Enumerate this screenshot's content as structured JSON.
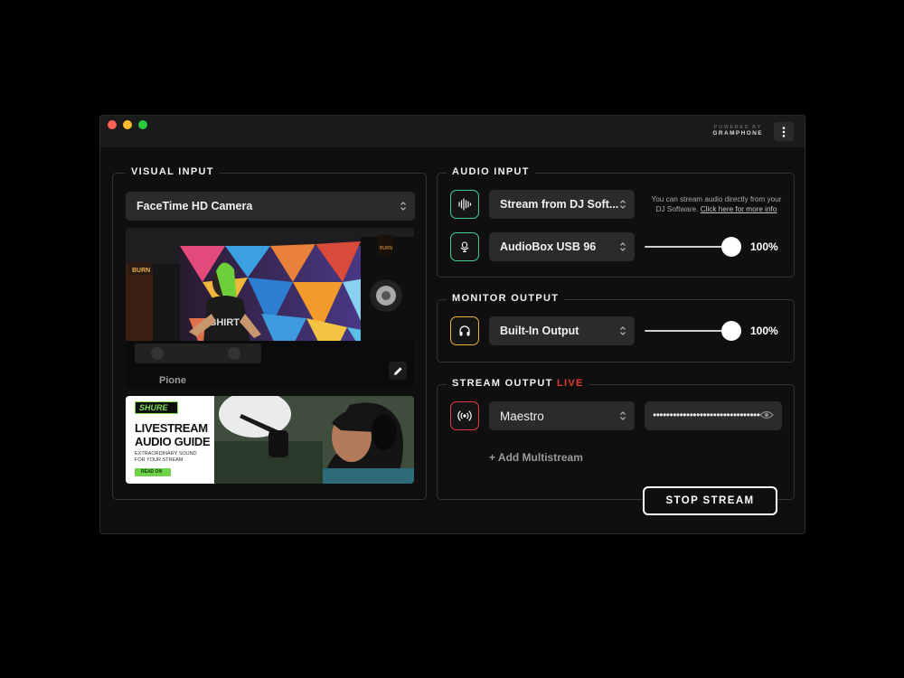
{
  "window": {
    "powered_by": "POWERED BY",
    "brand": "GRAMPHONE"
  },
  "visual_input": {
    "title": "VISUAL INPUT",
    "camera": "FaceTime HD Camera",
    "ad": {
      "brand": "SHURE",
      "headline_1": "LIVESTREAM",
      "headline_2": "AUDIO GUIDE",
      "sub_1": "EXTRAORDINARY SOUND",
      "sub_2": "FOR YOUR STREAM",
      "cta": "READ ON"
    }
  },
  "audio_input": {
    "title": "AUDIO INPUT",
    "source": "Stream from DJ Soft...",
    "note_line1": "You can stream audio directly from your",
    "note_line2": "DJ Software.",
    "note_link": "Click here for more info",
    "device": "AudioBox USB 96",
    "volume_label": "100%",
    "volume": 1.0
  },
  "monitor_output": {
    "title": "MONITOR OUTPUT",
    "device": "Built-In Output",
    "volume_label": "100%",
    "volume": 1.0
  },
  "stream_output": {
    "title": "STREAM OUTPUT",
    "live": "LIVE",
    "destination": "Maestro",
    "stream_key_masked": "••••••••••••••••••••••••••••••••",
    "add_multistream": "+ Add Multistream",
    "stop_label": "STOP STREAM"
  },
  "colors": {
    "green": "#3fd08e",
    "yellow": "#f0b13a",
    "red": "#e23b3b",
    "live": "#e53935"
  }
}
